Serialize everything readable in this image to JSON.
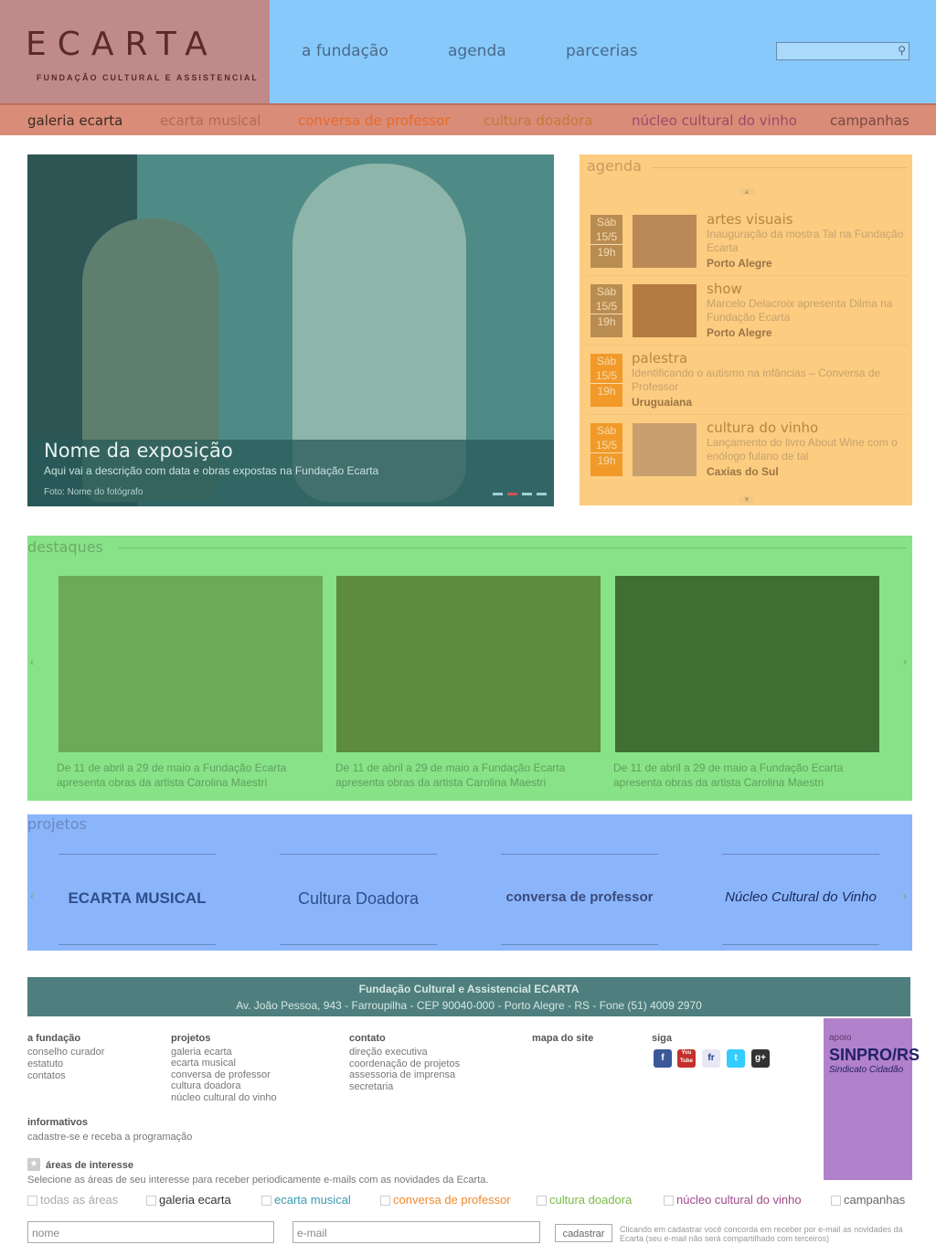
{
  "header": {
    "logo": "ECARTA",
    "logo_sub": "FUNDAÇÃO CULTURAL E ASSISTENCIAL",
    "nav": [
      "a fundação",
      "agenda",
      "parcerias"
    ]
  },
  "subnav": [
    "galeria ecarta",
    "ecarta musical",
    "conversa de professor",
    "cultura doadora",
    "núcleo cultural do vinho",
    "campanhas"
  ],
  "hero": {
    "title": "Nome da exposição",
    "desc": "Aqui vai a descrição com data e obras expostas na Fundação Ecarta",
    "photo": "Foto: Nome do fotógrafo"
  },
  "agenda": {
    "title": "agenda",
    "items": [
      {
        "day": "Sáb",
        "date": "15/5",
        "time": "19h",
        "cat": "artes visuais",
        "desc": "Inauguração da mostra Tal na Fundação Ecarta",
        "place": "Porto Alegre"
      },
      {
        "day": "Sáb",
        "date": "15/5",
        "time": "19h",
        "cat": "show",
        "desc": "Marcelo Delacroix apresenta Dilma na Fundação Ecarta",
        "place": "Porto Alegre"
      },
      {
        "day": "Sáb",
        "date": "15/5",
        "time": "19h",
        "cat": "palestra",
        "desc": "Identificando o autismo na infâncias – Conversa de Professor",
        "place": "Uruguaiana"
      },
      {
        "day": "Sáb",
        "date": "15/5",
        "time": "19h",
        "cat": "cultura do vinho",
        "desc": "Lançamento do livro About Wine com o enólogo fulano de tal",
        "place": "Caxias do Sul"
      }
    ]
  },
  "destaques": {
    "title": "destaques",
    "items": [
      {
        "line1": "De 11 de abril a 29 de maio a Fundação Ecarta",
        "line2": "apresenta obras da artista Carolina Maestri"
      },
      {
        "line1": "De 11 de abril a 29 de maio a Fundação Ecarta",
        "line2": "apresenta obras da artista Carolina Maestri"
      },
      {
        "line1": "De 11 de abril a 29 de maio a Fundação Ecarta",
        "line2": "apresenta obras da artista Carolina Maestri"
      }
    ]
  },
  "projetos": {
    "title": "projetos",
    "items": [
      "ECARTA MUSICAL",
      "Cultura Doadora",
      "conversa de professor",
      "Núcleo Cultural do Vinho"
    ]
  },
  "footer": {
    "name": "Fundação Cultural e Assistencial ECARTA",
    "address": "Av. João Pessoa, 943 - Farroupilha - CEP 90040-000 - Porto Alegre - RS - Fone (51) 4009 2970",
    "col_fundacao": {
      "title": "a fundação",
      "items": [
        "conselho curador",
        "estatuto",
        "contatos"
      ]
    },
    "col_projetos": {
      "title": "projetos",
      "items": [
        "galeria ecarta",
        "ecarta musical",
        "conversa de professor",
        "cultura doadora",
        "núcleo cultural do vinho"
      ]
    },
    "col_contato": {
      "title": "contato",
      "items": [
        "direção executiva",
        "coordenação de projetos",
        "assessoria de imprensa",
        "secretaria"
      ]
    },
    "mapa": "mapa do site",
    "siga": "siga",
    "social": [
      "f",
      "You Tube",
      "fr",
      "t",
      "g+"
    ],
    "informativos_title": "informativos",
    "informativos_text": "cadastre-se e receba a programação",
    "areas_title": "áreas de interesse",
    "areas_text": "Selecione as áreas de seu interesse para receber periodicamente e-mails com as novidades da Ecarta.",
    "checkboxes": [
      "todas as áreas",
      "galeria ecarta",
      "ecarta musical",
      "conversa de professor",
      "cultura doadora",
      "núcleo cultural do vinho",
      "campanhas"
    ],
    "name_placeholder": "nome",
    "email_placeholder": "e-mail",
    "button": "cadastrar",
    "notice": "Clicando em cadastrar você concorda em receber por e-mail as novidades da Ecarta (seu e-mail não será compartilhado com terceiros)",
    "apoio": "apoio",
    "sinpro": "SINPRO/RS",
    "sindicato": "Sindicato Cidadão"
  }
}
